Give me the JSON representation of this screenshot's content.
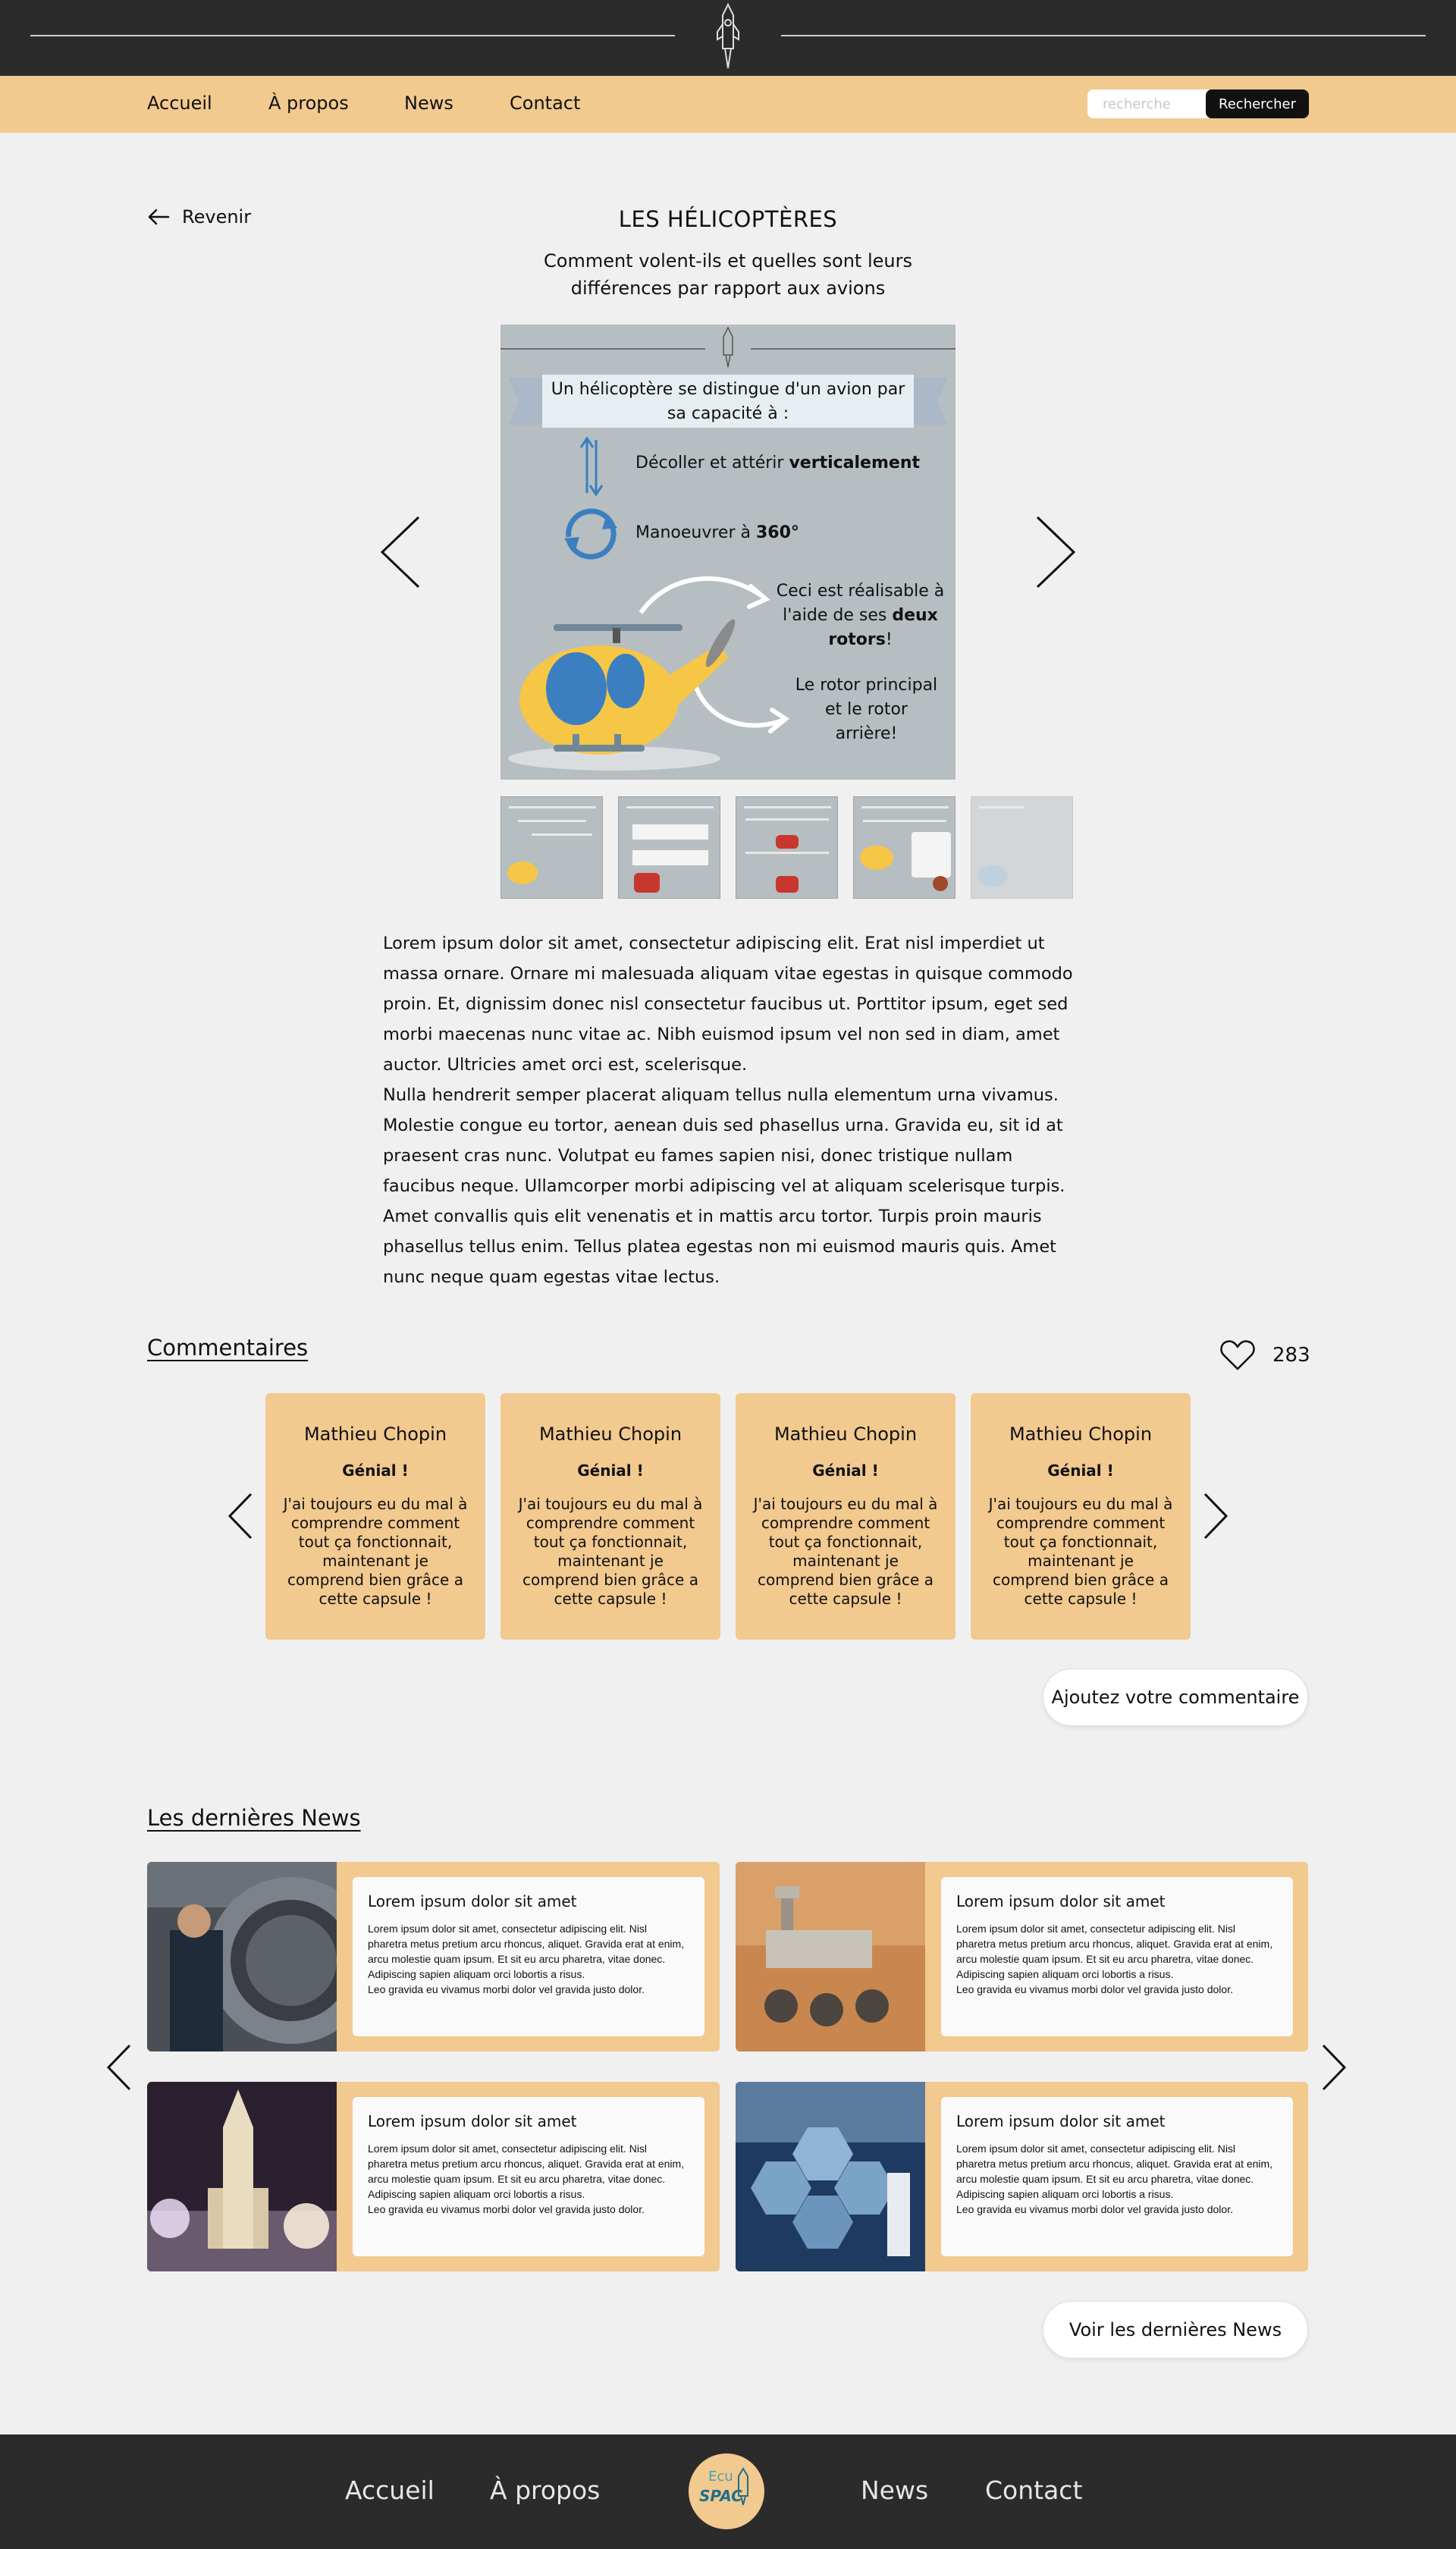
{
  "nav": {
    "items": [
      "Accueil",
      "À propos",
      "News",
      "Contact"
    ],
    "search_placeholder": "recherche",
    "search_button": "Rechercher"
  },
  "article": {
    "back_label": "Revenir",
    "title": "LES HÉLICOPTÈRES",
    "subtitle": "Comment volent-ils et quelles sont leurs différences par rapport aux avions",
    "slide": {
      "heading": "Un hélicoptère se distingue d'un avion par sa capacité à :",
      "line1_prefix": "Décoller et attérir ",
      "line1_bold": "verticalement",
      "line2_prefix": "Manoeuvrer à ",
      "line2_bold": "360°",
      "note1_prefix": "Ceci est réalisable à l'aide de ses ",
      "note1_bold": "deux rotors",
      "note1_suffix": "!",
      "note2": "Le rotor principal et le rotor arrière!"
    },
    "paragraph1": "Lorem ipsum dolor sit amet, consectetur adipiscing elit. Erat nisl imperdiet ut massa ornare. Ornare mi malesuada aliquam vitae egestas in quisque commodo proin. Et, dignissim donec nisl consectetur faucibus ut. Porttitor ipsum, eget sed morbi maecenas nunc vitae ac. Nibh euismod ipsum vel non sed in diam, amet auctor. Ultricies amet orci est, scelerisque.",
    "paragraph2": "Nulla hendrerit semper placerat aliquam tellus nulla elementum urna vivamus. Molestie congue eu tortor, aenean duis sed phasellus urna. Gravida eu, sit id at praesent cras nunc. Volutpat eu fames sapien nisi, donec tristique nullam faucibus neque. Ullamcorper morbi adipiscing vel at aliquam scelerisque turpis. Amet convallis quis elit venenatis et in mattis arcu tortor. Turpis proin mauris phasellus tellus enim. Tellus platea egestas non mi euismod mauris quis. Amet nunc neque quam egestas vitae lectus."
  },
  "comments": {
    "title": "Commentaires",
    "likes": "283",
    "items": [
      {
        "author": "Mathieu Chopin",
        "rating": "Génial !",
        "text": "J'ai toujours eu du mal à comprendre comment tout ça fonctionnait, maintenant je comprend bien grâce a cette capsule !"
      },
      {
        "author": "Mathieu Chopin",
        "rating": "Génial !",
        "text": "J'ai toujours eu du mal à comprendre comment tout ça fonctionnait, maintenant je comprend bien grâce a cette capsule !"
      },
      {
        "author": "Mathieu Chopin",
        "rating": "Génial !",
        "text": "J'ai toujours eu du mal à comprendre comment tout ça fonctionnait, maintenant je comprend bien grâce a cette capsule !"
      },
      {
        "author": "Mathieu Chopin",
        "rating": "Génial !",
        "text": "J'ai toujours eu du mal à comprendre comment tout ça fonctionnait, maintenant je comprend bien grâce a cette capsule !"
      }
    ],
    "add_button": "Ajoutez votre commentaire"
  },
  "news": {
    "title": "Les dernières News",
    "items": [
      {
        "title": "Lorem ipsum dolor sit amet",
        "text": "Lorem ipsum dolor sit amet, consectetur adipiscing elit. Nisl pharetra metus pretium arcu rhoncus, aliquet. Gravida erat at enim, arcu molestie quam ipsum. Et sit eu arcu pharetra, vitae donec. Adipiscing sapien aliquam orci lobortis a risus.\nLeo gravida eu vivamus morbi dolor vel gravida justo dolor."
      },
      {
        "title": "Lorem ipsum dolor sit amet",
        "text": "Lorem ipsum dolor sit amet, consectetur adipiscing elit. Nisl pharetra metus pretium arcu rhoncus, aliquet. Gravida erat at enim, arcu molestie quam ipsum. Et sit eu arcu pharetra, vitae donec. Adipiscing sapien aliquam orci lobortis a risus.\nLeo gravida eu vivamus morbi dolor vel gravida justo dolor."
      },
      {
        "title": "Lorem ipsum dolor sit amet",
        "text": "Lorem ipsum dolor sit amet, consectetur adipiscing elit. Nisl pharetra metus pretium arcu rhoncus, aliquet. Gravida erat at enim, arcu molestie quam ipsum. Et sit eu arcu pharetra, vitae donec. Adipiscing sapien aliquam orci lobortis a risus.\nLeo gravida eu vivamus morbi dolor vel gravida justo dolor."
      },
      {
        "title": "Lorem ipsum dolor sit amet",
        "text": "Lorem ipsum dolor sit amet, consectetur adipiscing elit. Nisl pharetra metus pretium arcu rhoncus, aliquet. Gravida erat at enim, arcu molestie quam ipsum. Et sit eu arcu pharetra, vitae donec. Adipiscing sapien aliquam orci lobortis a risus.\nLeo gravida eu vivamus morbi dolor vel gravida justo dolor."
      }
    ],
    "more_button": "Voir les dernières News"
  },
  "footer": {
    "items": [
      "Accueil",
      "À propos",
      "News",
      "Contact"
    ],
    "logo_text_top": "Ecu",
    "logo_text_bottom": "SPAC"
  },
  "colors": {
    "dark": "#2b2b2b",
    "accent": "#f2c98f",
    "background": "#f0f0f0",
    "slide": "#b6bec2"
  }
}
